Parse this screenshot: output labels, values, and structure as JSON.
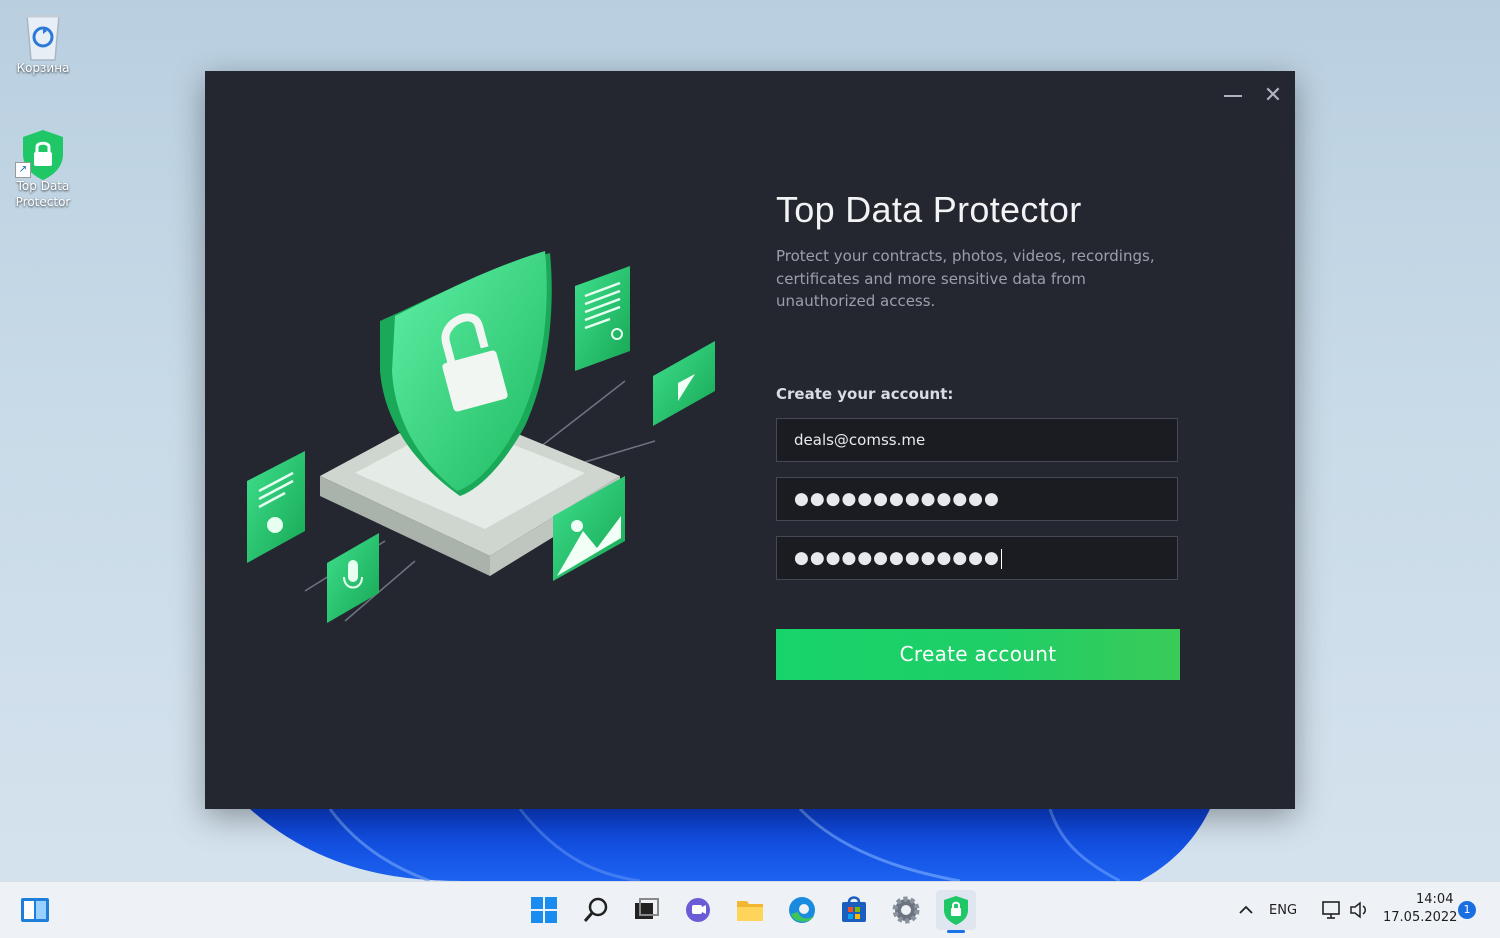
{
  "desktop": {
    "icons": [
      {
        "label": "Корзина",
        "icon": "recycle-bin-icon"
      },
      {
        "label": "Top Data\nProtector",
        "label_line1": "Top Data",
        "label_line2": "Protector",
        "icon": "app-shield-icon"
      }
    ]
  },
  "window": {
    "title": "Top Data Protector",
    "description": "Protect your contracts, photos, videos, recordings, certificates and more sensitive data from unauthorized access.",
    "form_label": "Create your account:",
    "email_value": "deals@comss.me",
    "password_value": "●●●●●●●●●●●●●",
    "confirm_password_value": "●●●●●●●●●●●●●",
    "submit_label": "Create account",
    "minimize_icon": "minimize-icon",
    "close_icon": "close-icon"
  },
  "taskbar": {
    "apps": [
      "widgets-icon",
      "start-icon",
      "search-icon",
      "task-view-icon",
      "teams-chat-icon",
      "file-explorer-icon",
      "edge-icon",
      "store-icon",
      "settings-icon",
      "top-data-protector-icon"
    ],
    "language": "ENG",
    "time": "14:04",
    "date": "17.05.2022",
    "notification_count": "1"
  },
  "colors": {
    "accent_green": "#1fce66",
    "window_bg": "#24272f",
    "field_bg": "#1a1c22"
  }
}
